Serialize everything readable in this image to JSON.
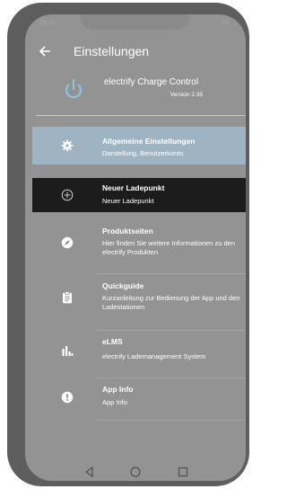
{
  "status": {
    "time": "15:15",
    "indicators": "4G"
  },
  "header": {
    "title": "Einstellungen",
    "back_icon": "arrow-left-icon"
  },
  "app": {
    "name": "electrify Charge Control",
    "version": "Version 2.35",
    "logo_icon": "power-icon"
  },
  "menu": [
    {
      "icon": "gear-icon",
      "title": "Allgemeine Einstellungen",
      "subtitle": "Darstellung, Benutzerkonto",
      "state": "selected"
    },
    {
      "icon": "plus-circle-icon",
      "title": "Neuer Ladepunkt",
      "subtitle": "Neuer Ladepunkt",
      "state": "focused"
    },
    {
      "icon": "compass-icon",
      "title": "Produktseiten",
      "subtitle": "Hier finden Sie weitere Informationen zu den electrify Produkten"
    },
    {
      "icon": "clipboard-icon",
      "title": "Quickguide",
      "subtitle": "Kurzanleitung zur Bedienung der App und den Ladestationen"
    },
    {
      "icon": "bar-chart-icon",
      "title": "eLMS",
      "subtitle": "electrify Lademanagement System"
    },
    {
      "icon": "info-icon",
      "title": "App Info",
      "subtitle": "App Info"
    }
  ],
  "colors": {
    "accent": "#9fb4c3",
    "focused": "#1c1c1c",
    "logo": "#8fc3e0"
  },
  "nav": [
    "back-triangle-icon",
    "home-circle-icon",
    "recents-square-icon"
  ]
}
